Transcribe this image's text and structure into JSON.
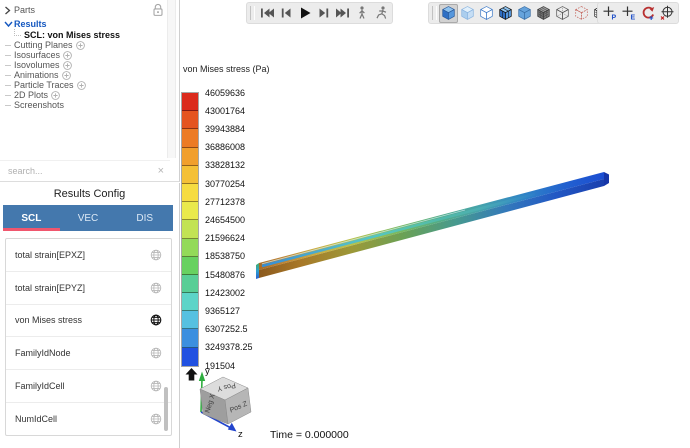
{
  "colors": {
    "accent_blue": "#1558c0",
    "tab_bar_blue": "#4478ad",
    "tab_underline_pink": "#f0566e",
    "toolbar_bg": "#ececec"
  },
  "tree_panel": {
    "items": [
      {
        "label": "Parts",
        "icon": "chevron-right"
      },
      {
        "label": "Results",
        "icon": "chevron-down",
        "accent": true
      },
      {
        "label": "SCL: von Mises stress",
        "child": true,
        "bold": true
      },
      {
        "label": "Cutting Planes",
        "plus": true
      },
      {
        "label": "Isosurfaces",
        "plus": true
      },
      {
        "label": "Isovolumes",
        "plus": true
      },
      {
        "label": "Animations",
        "plus": true
      },
      {
        "label": "Particle Traces",
        "plus": true
      },
      {
        "label": "2D Plots",
        "plus": true
      },
      {
        "label": "Screenshots"
      }
    ],
    "search_placeholder": "search...",
    "clear_glyph": "×"
  },
  "results_config": {
    "title": "Results Config",
    "tabs": [
      {
        "label": "SCL",
        "active": true
      },
      {
        "label": "VEC",
        "active": false
      },
      {
        "label": "DIS",
        "active": false
      }
    ],
    "variables": [
      {
        "label": "total strain[EPXZ]",
        "active": false
      },
      {
        "label": "total strain[EPYZ]",
        "active": false
      },
      {
        "label": "von Mises stress",
        "active": true
      },
      {
        "label": "FamilyIdNode",
        "active": false
      },
      {
        "label": "FamilyIdCell",
        "active": false
      },
      {
        "label": "NumIdCell",
        "active": false
      }
    ]
  },
  "toolbars": {
    "playback": {
      "buttons": [
        {
          "name": "skip-to-start"
        },
        {
          "name": "step-back"
        },
        {
          "name": "play"
        },
        {
          "name": "step-forward"
        },
        {
          "name": "skip-to-end"
        },
        {
          "name": "walk-animate"
        },
        {
          "name": "run-animate"
        }
      ]
    },
    "view": {
      "buttons": [
        {
          "name": "cube-shaded",
          "active": true
        },
        {
          "name": "cube-transparent"
        },
        {
          "name": "cube-hidden-line"
        },
        {
          "name": "cube-shaded-edges"
        },
        {
          "name": "cube-flat"
        },
        {
          "name": "cube-mesh"
        },
        {
          "name": "cube-wireframe"
        },
        {
          "name": "cube-feature-red"
        },
        {
          "name": "cube-grid"
        }
      ]
    },
    "probe": {
      "buttons": [
        {
          "name": "probe-point"
        },
        {
          "name": "probe-element"
        },
        {
          "name": "query-interactive"
        },
        {
          "name": "center-of-transform"
        }
      ]
    }
  },
  "viewport": {
    "legend": {
      "title": "von Mises stress (Pa)",
      "labels": [
        "46059636",
        "43001764",
        "39943884",
        "36886008",
        "33828132",
        "30770254",
        "27712378",
        "24654500",
        "21596624",
        "18538750",
        "15480876",
        "12423002",
        "9365127",
        "6307252.5",
        "3249378.25",
        "191504"
      ],
      "band_colors": [
        "#db2a1c",
        "#e4541f",
        "#ec7b25",
        "#f19f2d",
        "#f4c037",
        "#f6dc41",
        "#e9e94c",
        "#c2e354",
        "#93da59",
        "#67d160",
        "#58ce96",
        "#5dd4c8",
        "#56c1e1",
        "#3c8fdf",
        "#2151e1"
      ]
    },
    "triad": {
      "y_label": "y",
      "z_label": "z",
      "cube_faces": {
        "top": "Pos Y",
        "left": "Neg X",
        "right": "Pos Z"
      }
    },
    "time_label": "Time = 0.000000"
  }
}
